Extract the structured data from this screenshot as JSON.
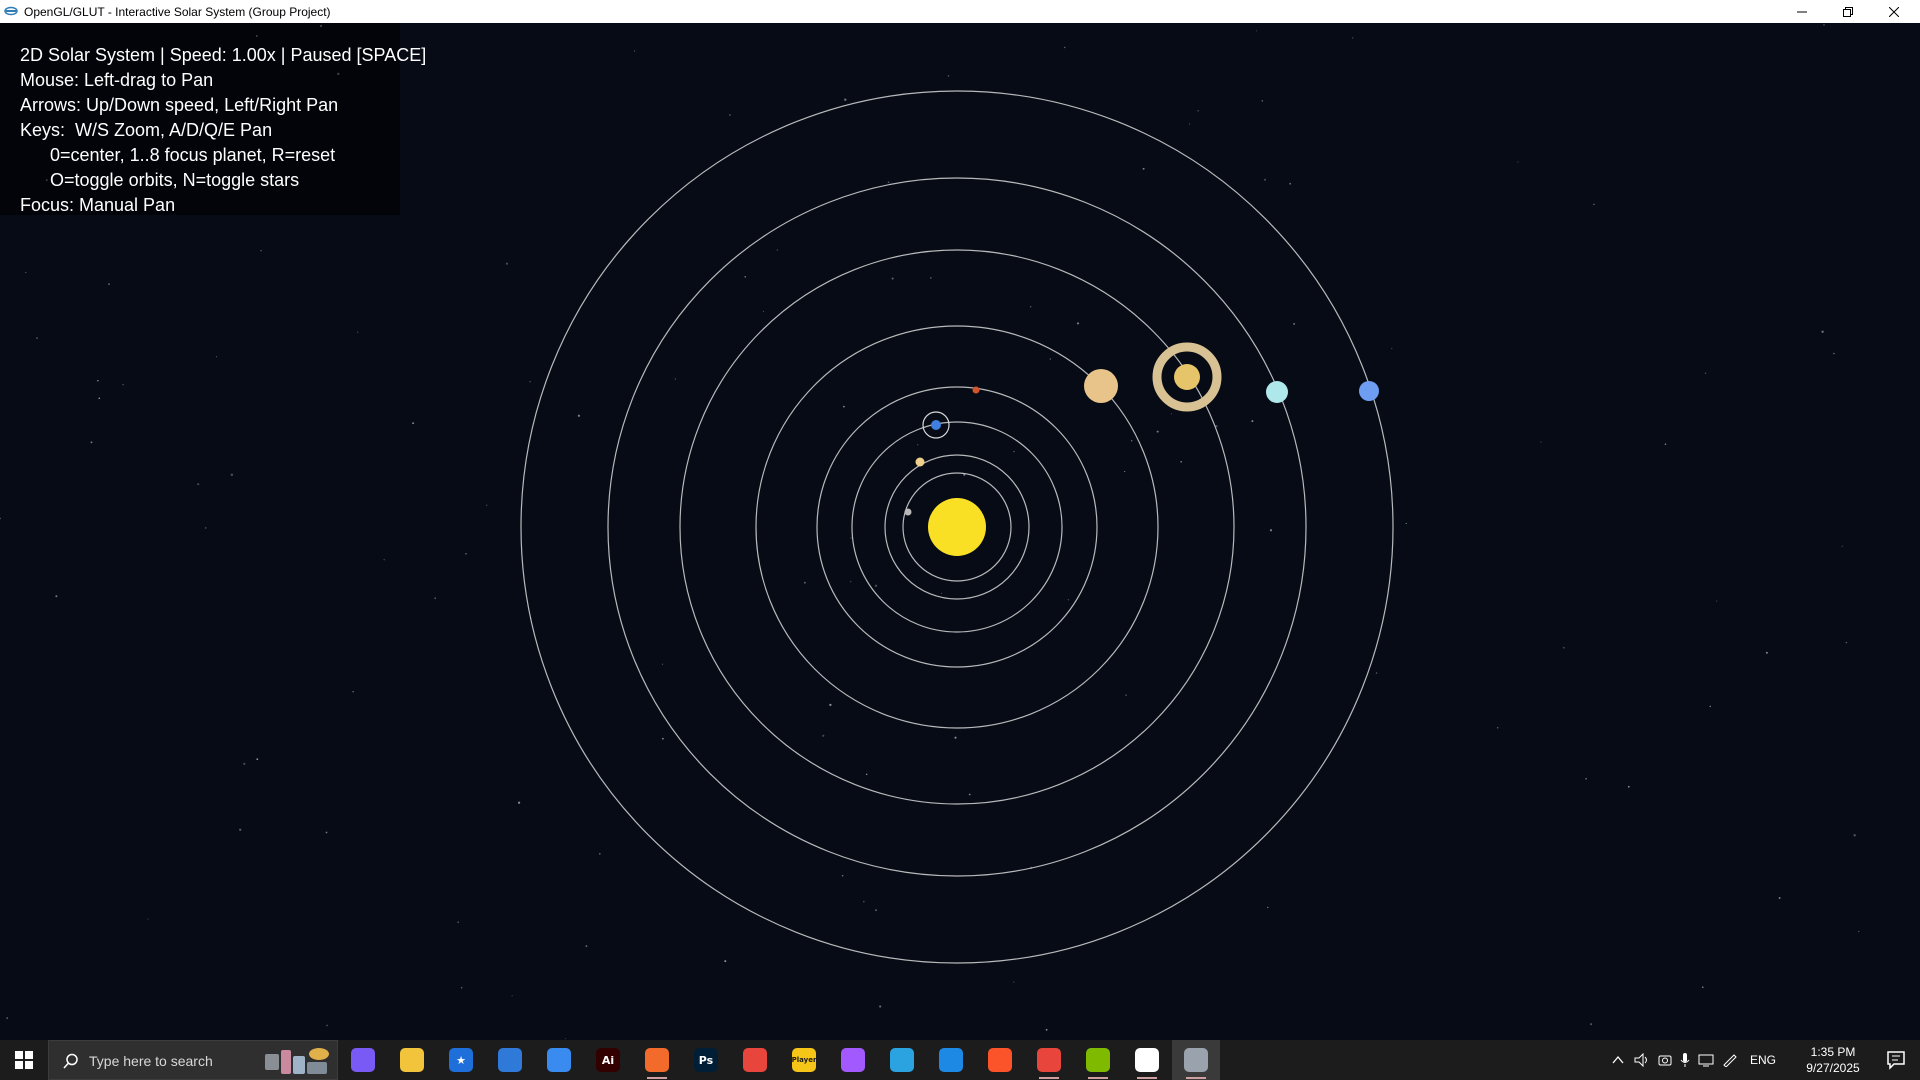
{
  "window": {
    "title": "OpenGL/GLUT - Interactive Solar System (Group Project)"
  },
  "hud": {
    "lines": [
      "2D Solar System | Speed: 1.00x | Paused [SPACE]",
      "Mouse: Left-drag to Pan",
      "Arrows: Up/Down speed, Left/Right Pan",
      "Keys:  W/S Zoom, A/D/Q/E Pan",
      "      0=center, 1..8 focus planet, R=reset",
      "      O=toggle orbits, N=toggle stars",
      "Focus: Manual Pan"
    ]
  },
  "scene": {
    "background": "#060b15",
    "orbit_color": "#d8d8d8",
    "sun": {
      "name": "Sun",
      "color": "#f9e024"
    },
    "planets": [
      {
        "name": "Mercury",
        "color": "#b8b8b8"
      },
      {
        "name": "Venus",
        "color": "#f0d08a"
      },
      {
        "name": "Earth",
        "color": "#3e7fe0",
        "has_moon_orbit": true
      },
      {
        "name": "Mars",
        "color": "#d2552e"
      },
      {
        "name": "Jupiter",
        "color": "#e8c48a"
      },
      {
        "name": "Saturn",
        "color": "#e6c46a",
        "ring_color": "#d8c294"
      },
      {
        "name": "Uranus",
        "color": "#aee8ea"
      },
      {
        "name": "Neptune",
        "color": "#6e9ef2"
      }
    ]
  },
  "taskbar": {
    "search_placeholder": "Type here to search",
    "apps": [
      {
        "name": "copilot",
        "glyph": "",
        "color": "#7a5af5"
      },
      {
        "name": "file-explorer",
        "glyph": "",
        "color": "#f2c43c"
      },
      {
        "name": "star-app",
        "glyph": "★",
        "color": "#1e6fd9"
      },
      {
        "name": "notes-app",
        "glyph": "",
        "color": "#2f7ad8"
      },
      {
        "name": "dev-app",
        "glyph": "",
        "color": "#3a8bf0"
      },
      {
        "name": "illustrator",
        "glyph": "Ai",
        "color": "#330000"
      },
      {
        "name": "brush-app",
        "glyph": "",
        "color": "#f36b2a"
      },
      {
        "name": "photoshop",
        "glyph": "Ps",
        "color": "#001e36"
      },
      {
        "name": "chrome",
        "glyph": "",
        "color": "#e8453c"
      },
      {
        "name": "player-app",
        "glyph": "Player",
        "color": "#f5c518"
      },
      {
        "name": "figma",
        "glyph": "",
        "color": "#a259ff"
      },
      {
        "name": "telegram",
        "glyph": "",
        "color": "#2aa3e0"
      },
      {
        "name": "vscode",
        "glyph": "",
        "color": "#1e88e5"
      },
      {
        "name": "brave",
        "glyph": "",
        "color": "#fb542b"
      },
      {
        "name": "chrome-wp",
        "glyph": "",
        "color": "#e8453c"
      },
      {
        "name": "store-app",
        "glyph": "",
        "color": "#7fba00"
      },
      {
        "name": "window-app",
        "glyph": "",
        "color": "#ffffff"
      },
      {
        "name": "opengl-app",
        "glyph": "",
        "color": "#9aa3ad"
      }
    ],
    "language": "ENG",
    "time": "1:35 PM",
    "date": "9/27/2025"
  }
}
